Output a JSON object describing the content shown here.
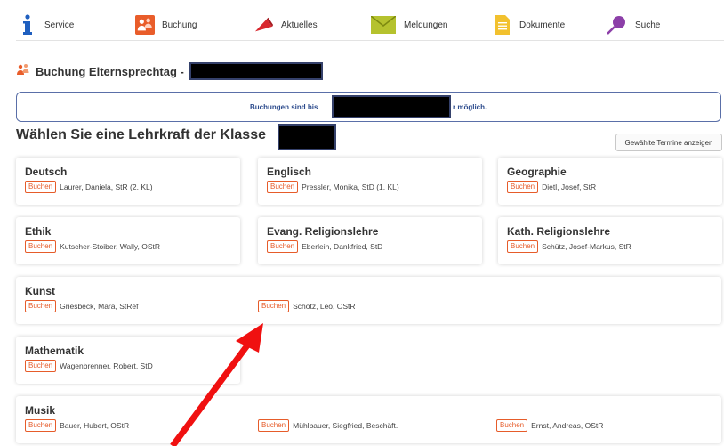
{
  "nav": {
    "items": [
      {
        "label": "Service",
        "icon": "info-icon"
      },
      {
        "label": "Buchung",
        "icon": "people-icon"
      },
      {
        "label": "Aktuelles",
        "icon": "megaphone-icon"
      },
      {
        "label": "Meldungen",
        "icon": "envelope-icon"
      },
      {
        "label": "Dokumente",
        "icon": "document-icon"
      },
      {
        "label": "Suche",
        "icon": "search-icon"
      }
    ]
  },
  "page": {
    "title": "Buchung Elternsprechtag -",
    "info_before": "Buchungen sind bis",
    "info_after": "r möglich.",
    "heading": "Wählen Sie eine Lehrkraft der Klasse",
    "show_button": "Gewählte Termine anzeigen",
    "buchen_label": "Buchen"
  },
  "cards": [
    {
      "subject": "Deutsch",
      "teachers": [
        "Laurer, Daniela, StR (2. KL)"
      ]
    },
    {
      "subject": "Englisch",
      "teachers": [
        "Pressler, Monika, StD (1. KL)"
      ]
    },
    {
      "subject": "Geographie",
      "teachers": [
        "Dietl, Josef, StR"
      ]
    },
    {
      "subject": "Ethik",
      "teachers": [
        "Kutscher-Stoiber, Wally, OStR"
      ]
    },
    {
      "subject": "Evang. Religionslehre",
      "teachers": [
        "Eberlein, Dankfried, StD"
      ]
    },
    {
      "subject": "Kath. Religionslehre",
      "teachers": [
        "Schütz, Josef-Markus, StR"
      ]
    },
    {
      "subject": "Kunst",
      "teachers": [
        "Griesbeck, Mara, StRef",
        "Schötz, Leo, OStR"
      ]
    },
    {
      "subject": "Mathematik",
      "teachers": [
        "Wagenbrenner, Robert, StD"
      ]
    },
    {
      "subject": "Musik",
      "teachers": [
        "Bauer, Hubert, OStR",
        "Mühlbauer, Siegfried, Beschäft.",
        "Ernst, Andreas, OStR"
      ]
    }
  ],
  "colors": {
    "accent": "#e65c2a",
    "info_text": "#2b4a8c",
    "arrow": "#f01010"
  }
}
